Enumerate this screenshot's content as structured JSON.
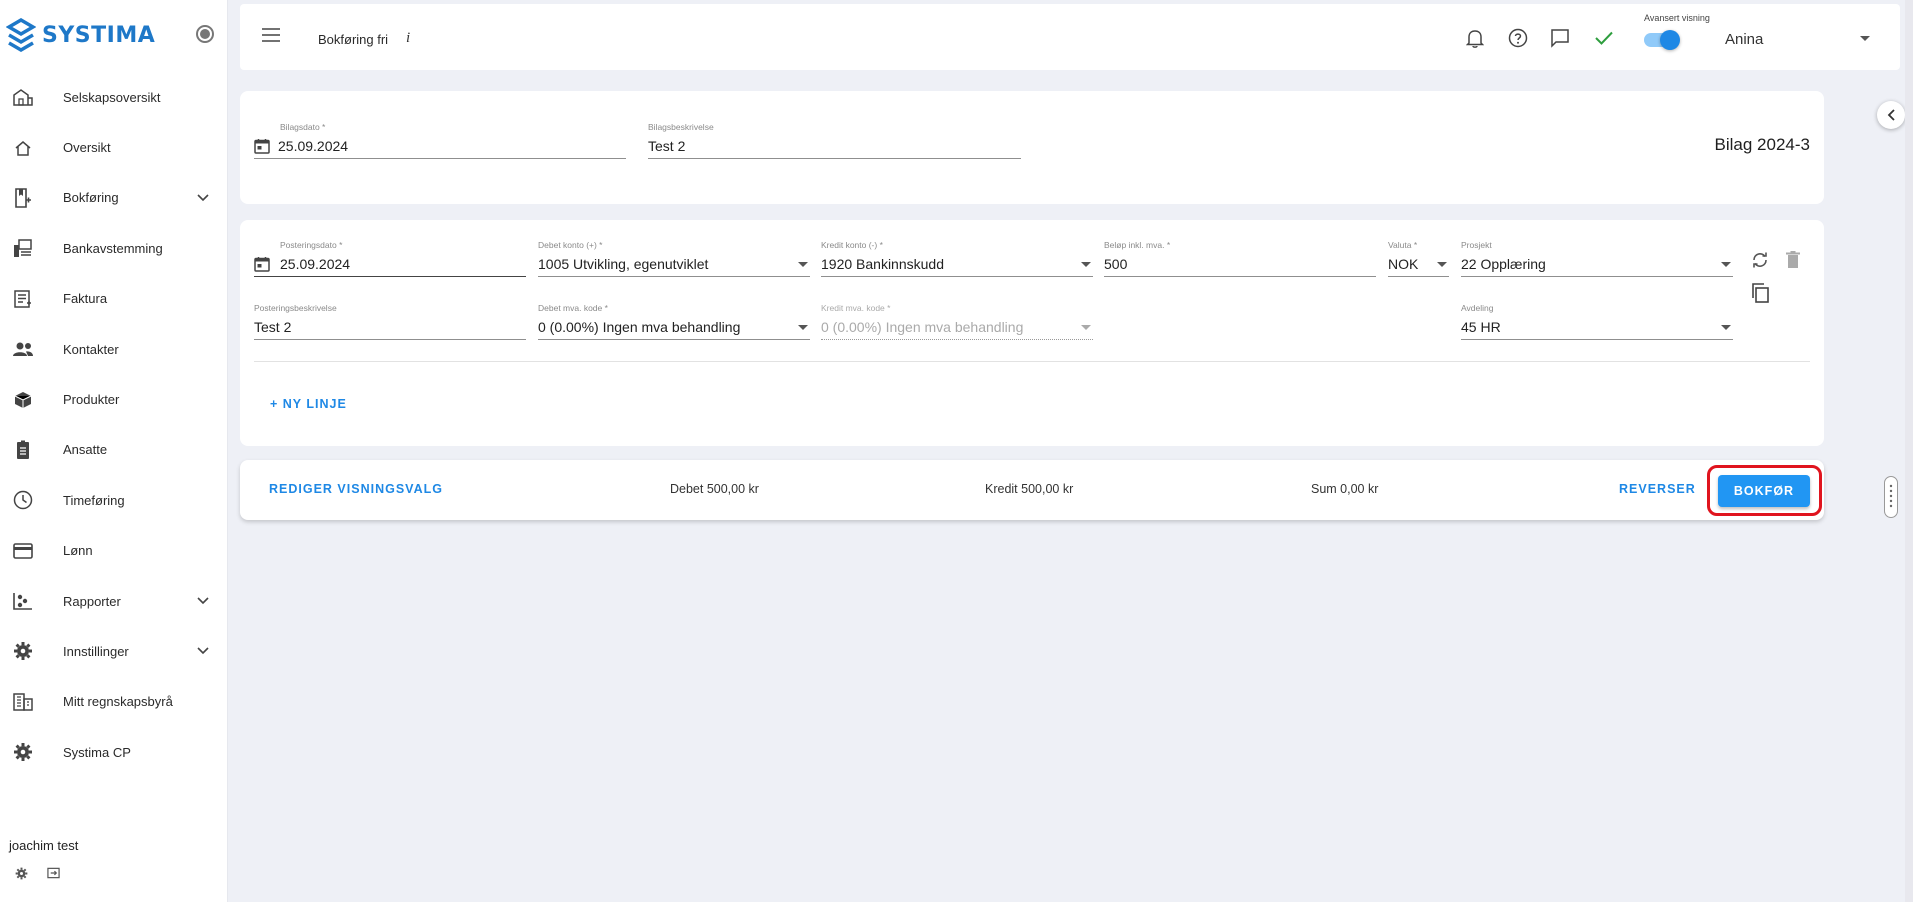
{
  "brand": {
    "name": "SYSTIMA",
    "color": "#1e78c8"
  },
  "sidebar": {
    "items": [
      {
        "label": "Selskapsoversikt",
        "icon": "buildings-icon",
        "expandable": false
      },
      {
        "label": "Oversikt",
        "icon": "home-icon",
        "expandable": false
      },
      {
        "label": "Bokføring",
        "icon": "book-add-icon",
        "expandable": true
      },
      {
        "label": "Bankavstemming",
        "icon": "bank-icon",
        "expandable": false
      },
      {
        "label": "Faktura",
        "icon": "invoice-icon",
        "expandable": false
      },
      {
        "label": "Kontakter",
        "icon": "people-icon",
        "expandable": false
      },
      {
        "label": "Produkter",
        "icon": "box-icon",
        "expandable": false
      },
      {
        "label": "Ansatte",
        "icon": "badge-icon",
        "expandable": false
      },
      {
        "label": "Timeføring",
        "icon": "clock-icon",
        "expandable": false
      },
      {
        "label": "Lønn",
        "icon": "card-icon",
        "expandable": false
      },
      {
        "label": "Rapporter",
        "icon": "report-icon",
        "expandable": true
      },
      {
        "label": "Innstillinger",
        "icon": "gear-icon",
        "expandable": true
      },
      {
        "label": "Mitt regnskapsbyrå",
        "icon": "office-icon",
        "expandable": false
      },
      {
        "label": "Systima CP",
        "icon": "gear-icon",
        "expandable": false
      }
    ],
    "user": "joachim test"
  },
  "topbar": {
    "title": "Bokføring fri",
    "info": "i",
    "advanced_label": "Avansert visning",
    "advanced_on": true,
    "user": "Anina"
  },
  "voucher": {
    "date_label": "Bilagsdato *",
    "date_value": "25.09.2024",
    "desc_label": "Bilagsbeskrivelse",
    "desc_value": "Test 2",
    "title": "Bilag 2024-3"
  },
  "line": {
    "posting_date_label": "Posteringsdato *",
    "posting_date_value": "25.09.2024",
    "debit_label": "Debet konto (+) *",
    "debit_value": "1005 Utvikling, egenutviklet",
    "credit_label": "Kredit konto (-) *",
    "credit_value": "1920 Bankinnskudd",
    "amount_label": "Beløp inkl. mva. *",
    "amount_value": "500",
    "currency_label": "Valuta *",
    "currency_value": "NOK",
    "project_label": "Prosjekt",
    "project_value": "22 Opplæring",
    "posting_desc_label": "Posteringsbeskrivelse",
    "posting_desc_value": "Test 2",
    "debit_vat_label": "Debet mva. kode *",
    "debit_vat_value": "0 (0.00%) Ingen mva behandling",
    "credit_vat_label": "Kredit mva. kode *",
    "credit_vat_value": "0 (0.00%) Ingen mva behandling",
    "department_label": "Avdeling",
    "department_value": "45 HR"
  },
  "actions": {
    "new_line": "+ NY LINJE",
    "edit_view": "REDIGER VISNINGSVALG",
    "debit_sum": "Debet 500,00 kr",
    "credit_sum": "Kredit 500,00 kr",
    "sum": "Sum 0,00 kr",
    "reverse": "REVERSER",
    "post": "BOKFØR"
  },
  "colors": {
    "accent": "#1e88e5",
    "primary_button": "#2196f3",
    "highlight": "#e0141e",
    "check": "#2e9e3e"
  }
}
